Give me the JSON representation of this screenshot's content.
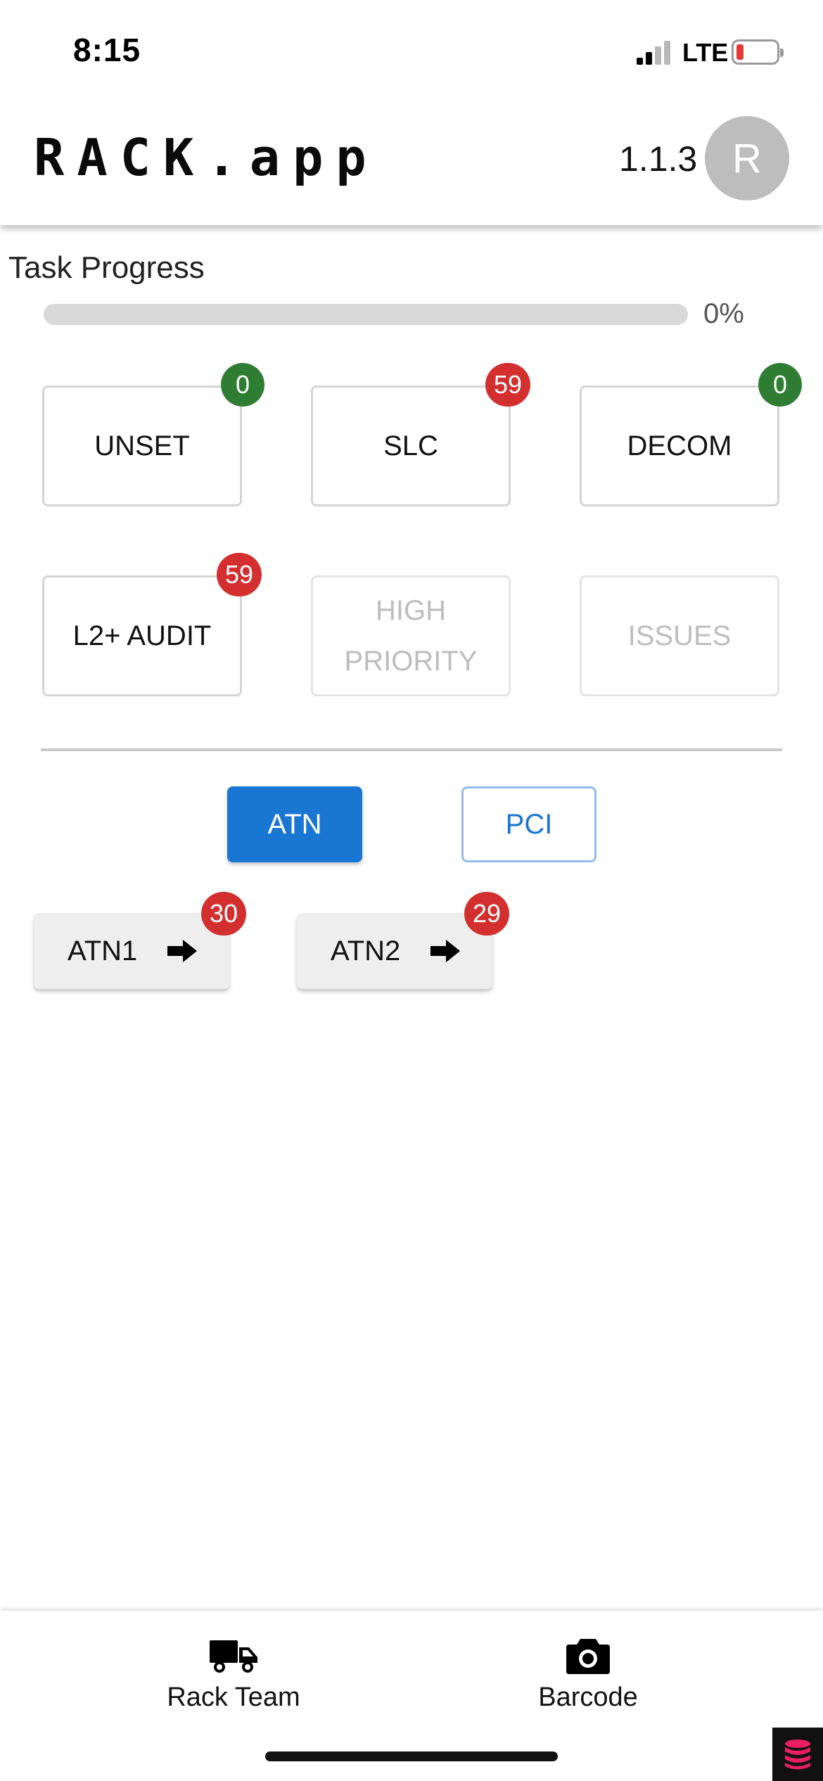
{
  "status_bar": {
    "time": "8:15",
    "network": "LTE"
  },
  "header": {
    "title": "RACK.app",
    "version": "1.1.3",
    "avatar_initial": "R"
  },
  "progress": {
    "label": "Task Progress",
    "percent_text": "0%",
    "value": 0
  },
  "categories": [
    {
      "label": "UNSET",
      "badge": "0",
      "badge_color": "#2e7d32",
      "enabled": true
    },
    {
      "label": "SLC",
      "badge": "59",
      "badge_color": "#d32f2f",
      "enabled": true
    },
    {
      "label": "DECOM",
      "badge": "0",
      "badge_color": "#2e7d32",
      "enabled": true
    },
    {
      "label": "L2+ AUDIT",
      "badge": "59",
      "badge_color": "#d32f2f",
      "enabled": true
    },
    {
      "label": "HIGH\nPRIORITY",
      "enabled": false
    },
    {
      "label": "ISSUES",
      "enabled": false
    }
  ],
  "toggle": {
    "options": [
      "ATN",
      "PCI"
    ],
    "selected": "ATN",
    "accent": "#1976d2"
  },
  "sub_items": [
    {
      "label": "ATN1",
      "badge": "30",
      "icon": "arrow-right-icon"
    },
    {
      "label": "ATN2",
      "badge": "29",
      "icon": "arrow-right-icon"
    }
  ],
  "bottom_nav": [
    {
      "label": "Rack Team",
      "icon": "truck-icon"
    },
    {
      "label": "Barcode",
      "icon": "camera-icon"
    }
  ]
}
